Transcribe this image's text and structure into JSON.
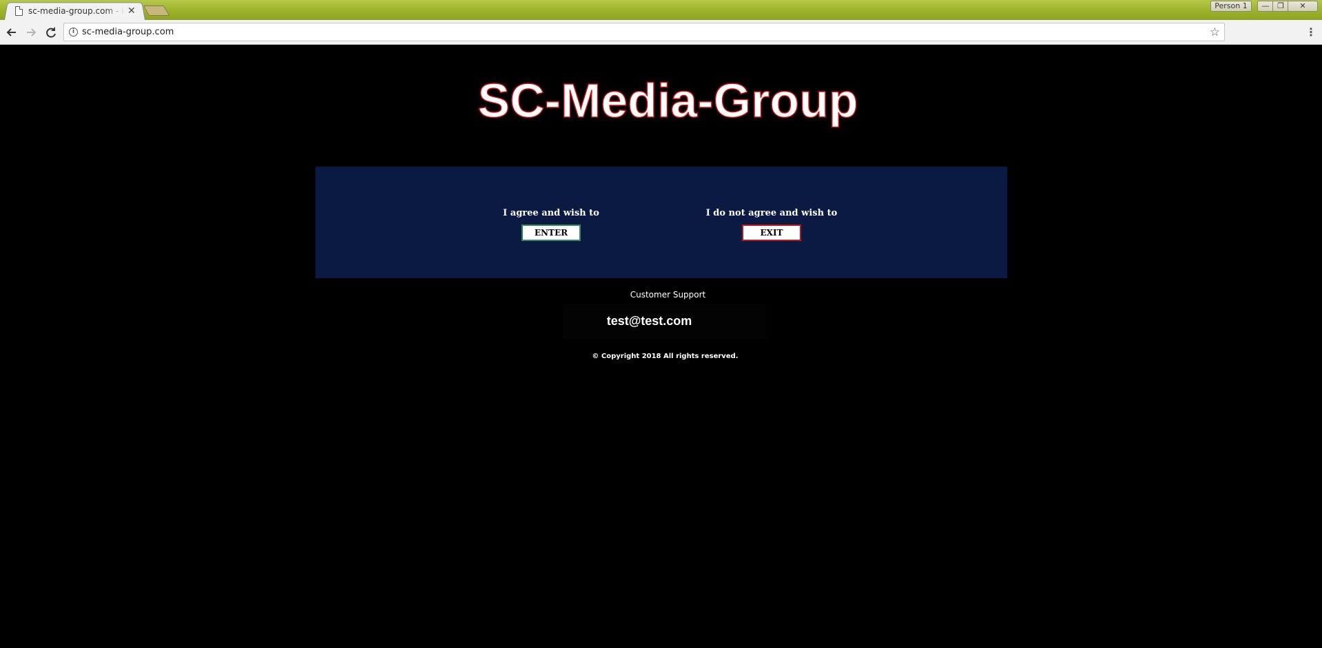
{
  "browser": {
    "tab_title": "sc-media-group.com - H",
    "tab_close": "✕",
    "profile_label": "Person 1",
    "url": "sc-media-group.com",
    "window_controls": {
      "minimize": "—",
      "restore": "❐",
      "close": "✕"
    },
    "icons": {
      "back": "arrow-left-icon",
      "forward": "arrow-right-icon",
      "reload": "reload-icon",
      "info": "info-icon",
      "bookmark": "star-icon",
      "menu": "kebab-menu-icon"
    }
  },
  "page": {
    "logo_text": "SC-Media-Group",
    "agree": {
      "label": "I agree and wish to",
      "button": "ENTER"
    },
    "disagree": {
      "label": "I do not agree and wish to",
      "button": "EXIT"
    },
    "support_label": "Customer Support",
    "support_email": "test@test.com",
    "copyright": "© Copyright 2018 All rights reserved."
  },
  "colors": {
    "page_background": "#000000",
    "panel_background": "#0a1a42",
    "logo_fill": "#ffffff",
    "logo_outline": "#cc1111",
    "enter_border": "#2e8b57",
    "exit_border": "#c01818",
    "tabstrip": "#9cb22a"
  }
}
